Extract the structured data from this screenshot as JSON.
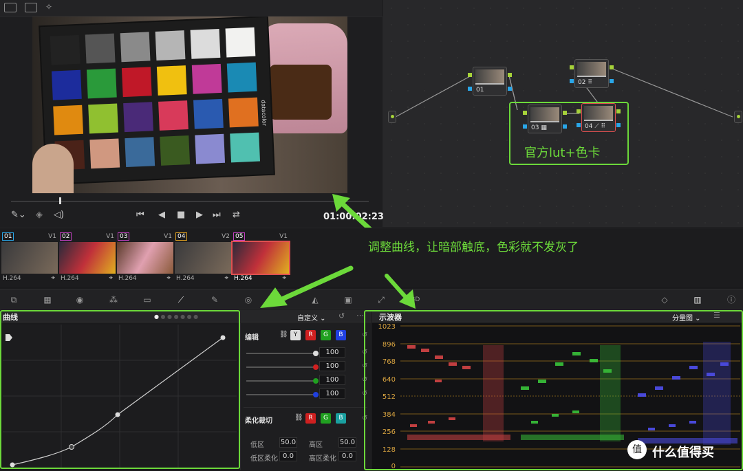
{
  "viewer": {
    "timecode": "01:00:02:23",
    "card_brand": "datacolor"
  },
  "nodes": {
    "items": [
      {
        "label": "01"
      },
      {
        "label": "02 ⠿"
      },
      {
        "label": "03 ▦"
      },
      {
        "label": "04 ⟋ ⠿"
      }
    ],
    "box_label": "官方lut+色卡"
  },
  "clips": [
    {
      "num": "01",
      "track": "V1",
      "codec": "H.264",
      "color": "#2aa6e8"
    },
    {
      "num": "02",
      "track": "V1",
      "codec": "H.264",
      "color": "#c040c0"
    },
    {
      "num": "03",
      "track": "V1",
      "codec": "H.264",
      "color": "#c040c0"
    },
    {
      "num": "04",
      "track": "V2",
      "codec": "H.264",
      "color": "#e0a020"
    },
    {
      "num": "05",
      "track": "V1",
      "codec": "H.264",
      "color": "#c040c0"
    }
  ],
  "annotation_curve": "调整曲线，让暗部触底，色彩就不发灰了",
  "curves": {
    "title": "曲线",
    "mode": "自定义 ⌄",
    "edit_label": "编辑",
    "channels": [
      "Y",
      "R",
      "G",
      "B"
    ],
    "values": [
      "100",
      "100",
      "100",
      "100"
    ],
    "soft_clip_label": "柔化裁切",
    "soft_channels": [
      "R",
      "G",
      "B"
    ],
    "low_label": "低区",
    "low_value": "50.0",
    "high_label": "高区",
    "high_value": "50.0",
    "low_soft_label": "低区柔化",
    "low_soft_value": "0.0",
    "high_soft_label": "高区柔化",
    "high_soft_value": "0.0"
  },
  "scope": {
    "title": "示波器",
    "mode": "分量图 ⌄",
    "axis": [
      "1023",
      "896",
      "768",
      "640",
      "512",
      "384",
      "256",
      "128",
      "0"
    ]
  },
  "watermark": {
    "icon": "值",
    "text": "什么值得买"
  },
  "colors": {
    "accent_green": "#6cd93a",
    "selected_red": "#e05050",
    "scope_red": "#e04848",
    "scope_green": "#3ccf3c",
    "scope_blue": "#5050f0"
  }
}
